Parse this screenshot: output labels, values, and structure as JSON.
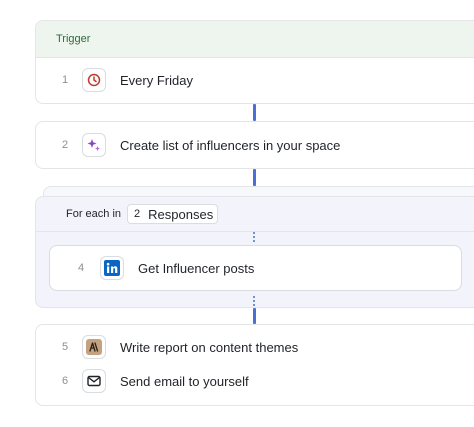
{
  "trigger": {
    "header_label": "Trigger",
    "step": {
      "number": "1",
      "label": "Every Friday",
      "icon": "clock-icon"
    }
  },
  "step2": {
    "number": "2",
    "label": "Create list of influencers in your space",
    "icon": "sparkle-icon"
  },
  "loop": {
    "prefix": "For each in",
    "count": "2",
    "unit": "Responses",
    "inner_step": {
      "number": "4",
      "label": "Get Influencer posts",
      "icon": "linkedin-icon"
    }
  },
  "final_steps": [
    {
      "number": "5",
      "label": "Write report on content themes",
      "icon": "ai-writer-icon"
    },
    {
      "number": "6",
      "label": "Send email to yourself",
      "icon": "mail-icon"
    }
  ],
  "colors": {
    "connector": "#4a6fd6",
    "trigger_header_bg": "#eef5ef",
    "trigger_header_text": "#2f6b3a",
    "loop_bg": "#f2f3fb",
    "clock": "#c0392b",
    "sparkle": "#8e44c9",
    "linkedin": "#0a66c2"
  }
}
